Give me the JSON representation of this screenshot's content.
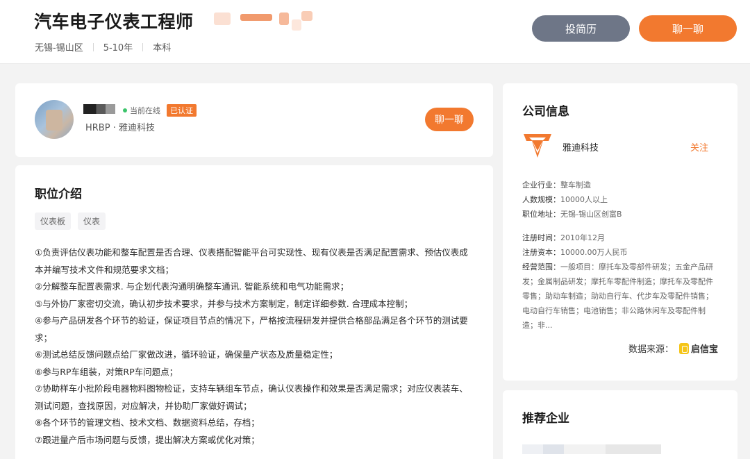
{
  "header": {
    "job_title": "汽车电子仪表工程师",
    "location": "无锡-锡山区",
    "experience": "5-10年",
    "education": "本科",
    "resume_button": "投简历",
    "chat_button": "聊一聊"
  },
  "recruiter": {
    "online_status": "当前在线",
    "verified_badge": "已认证",
    "company_line": "HRBP · 雅迪科技",
    "chat_button": "聊一聊"
  },
  "job": {
    "section_title": "职位介绍",
    "tags": [
      "仪表板",
      "仪表"
    ],
    "lines": [
      "①负责评估仪表功能和整车配置是否合理、仪表搭配智能平台可实现性、现有仪表是否满足配置需求、预估仪表成本并编写技术文件和规范要求文档；",
      "②分解整车配置表需求. 与企划代表沟通明确整车通讯. 智能系统和电气功能需求；",
      "⑤与外协厂家密切交流，确认初步技术要求，并参与技术方案制定，制定详细参数. 合理成本控制；",
      "④参与产品研发各个环节的验证，保证项目节点的情况下，严格按流程研发并提供合格部品满足各个环节的测试要求；",
      "⑥测试总结反馈问题点给厂家做改进，循环验证，确保量产状态及质量稳定性；",
      "⑥参与RP车组装，对策RP车问题点；",
      "⑦协助样车小批阶段电器物料图物检证，支持车辆组车节点，确认仪表操作和效果是否满足需求；对应仪表装车、测试问题，查找原因，对应解决，并协助厂家做好调试；",
      "⑧各个环节的管理文档、技术文档、数据资料总结，存档；",
      "⑦跟进量产后市场问题与反馈，提出解决方案或优化对策；"
    ]
  },
  "company": {
    "section_title": "公司信息",
    "name": "雅迪科技",
    "follow": "关注",
    "industry_label": "企业行业：",
    "industry": "整车制造",
    "size_label": "人数规模：",
    "size": "10000人以上",
    "address_label": "职位地址：",
    "address": "无锡-锡山区创富B",
    "reg_date_label": "注册时间：",
    "reg_date": "2010年12月",
    "capital_label": "注册资本：",
    "capital": "10000.00万人民币",
    "scope_label": "经营范围：",
    "scope": "一般项目：摩托车及零部件研发；五金产品研发；金属制品研发；摩托车零配件制造；摩托车及零配件零售；助动车制造；助动自行车、代步车及零配件销售；电动自行车销售；电池销售；非公路休闲车及零配件制造；非...",
    "source_label": "数据来源：",
    "source_brand": "启信宝",
    "brand_color": "#f2792f"
  },
  "recommend": {
    "section_title": "推荐企业"
  }
}
